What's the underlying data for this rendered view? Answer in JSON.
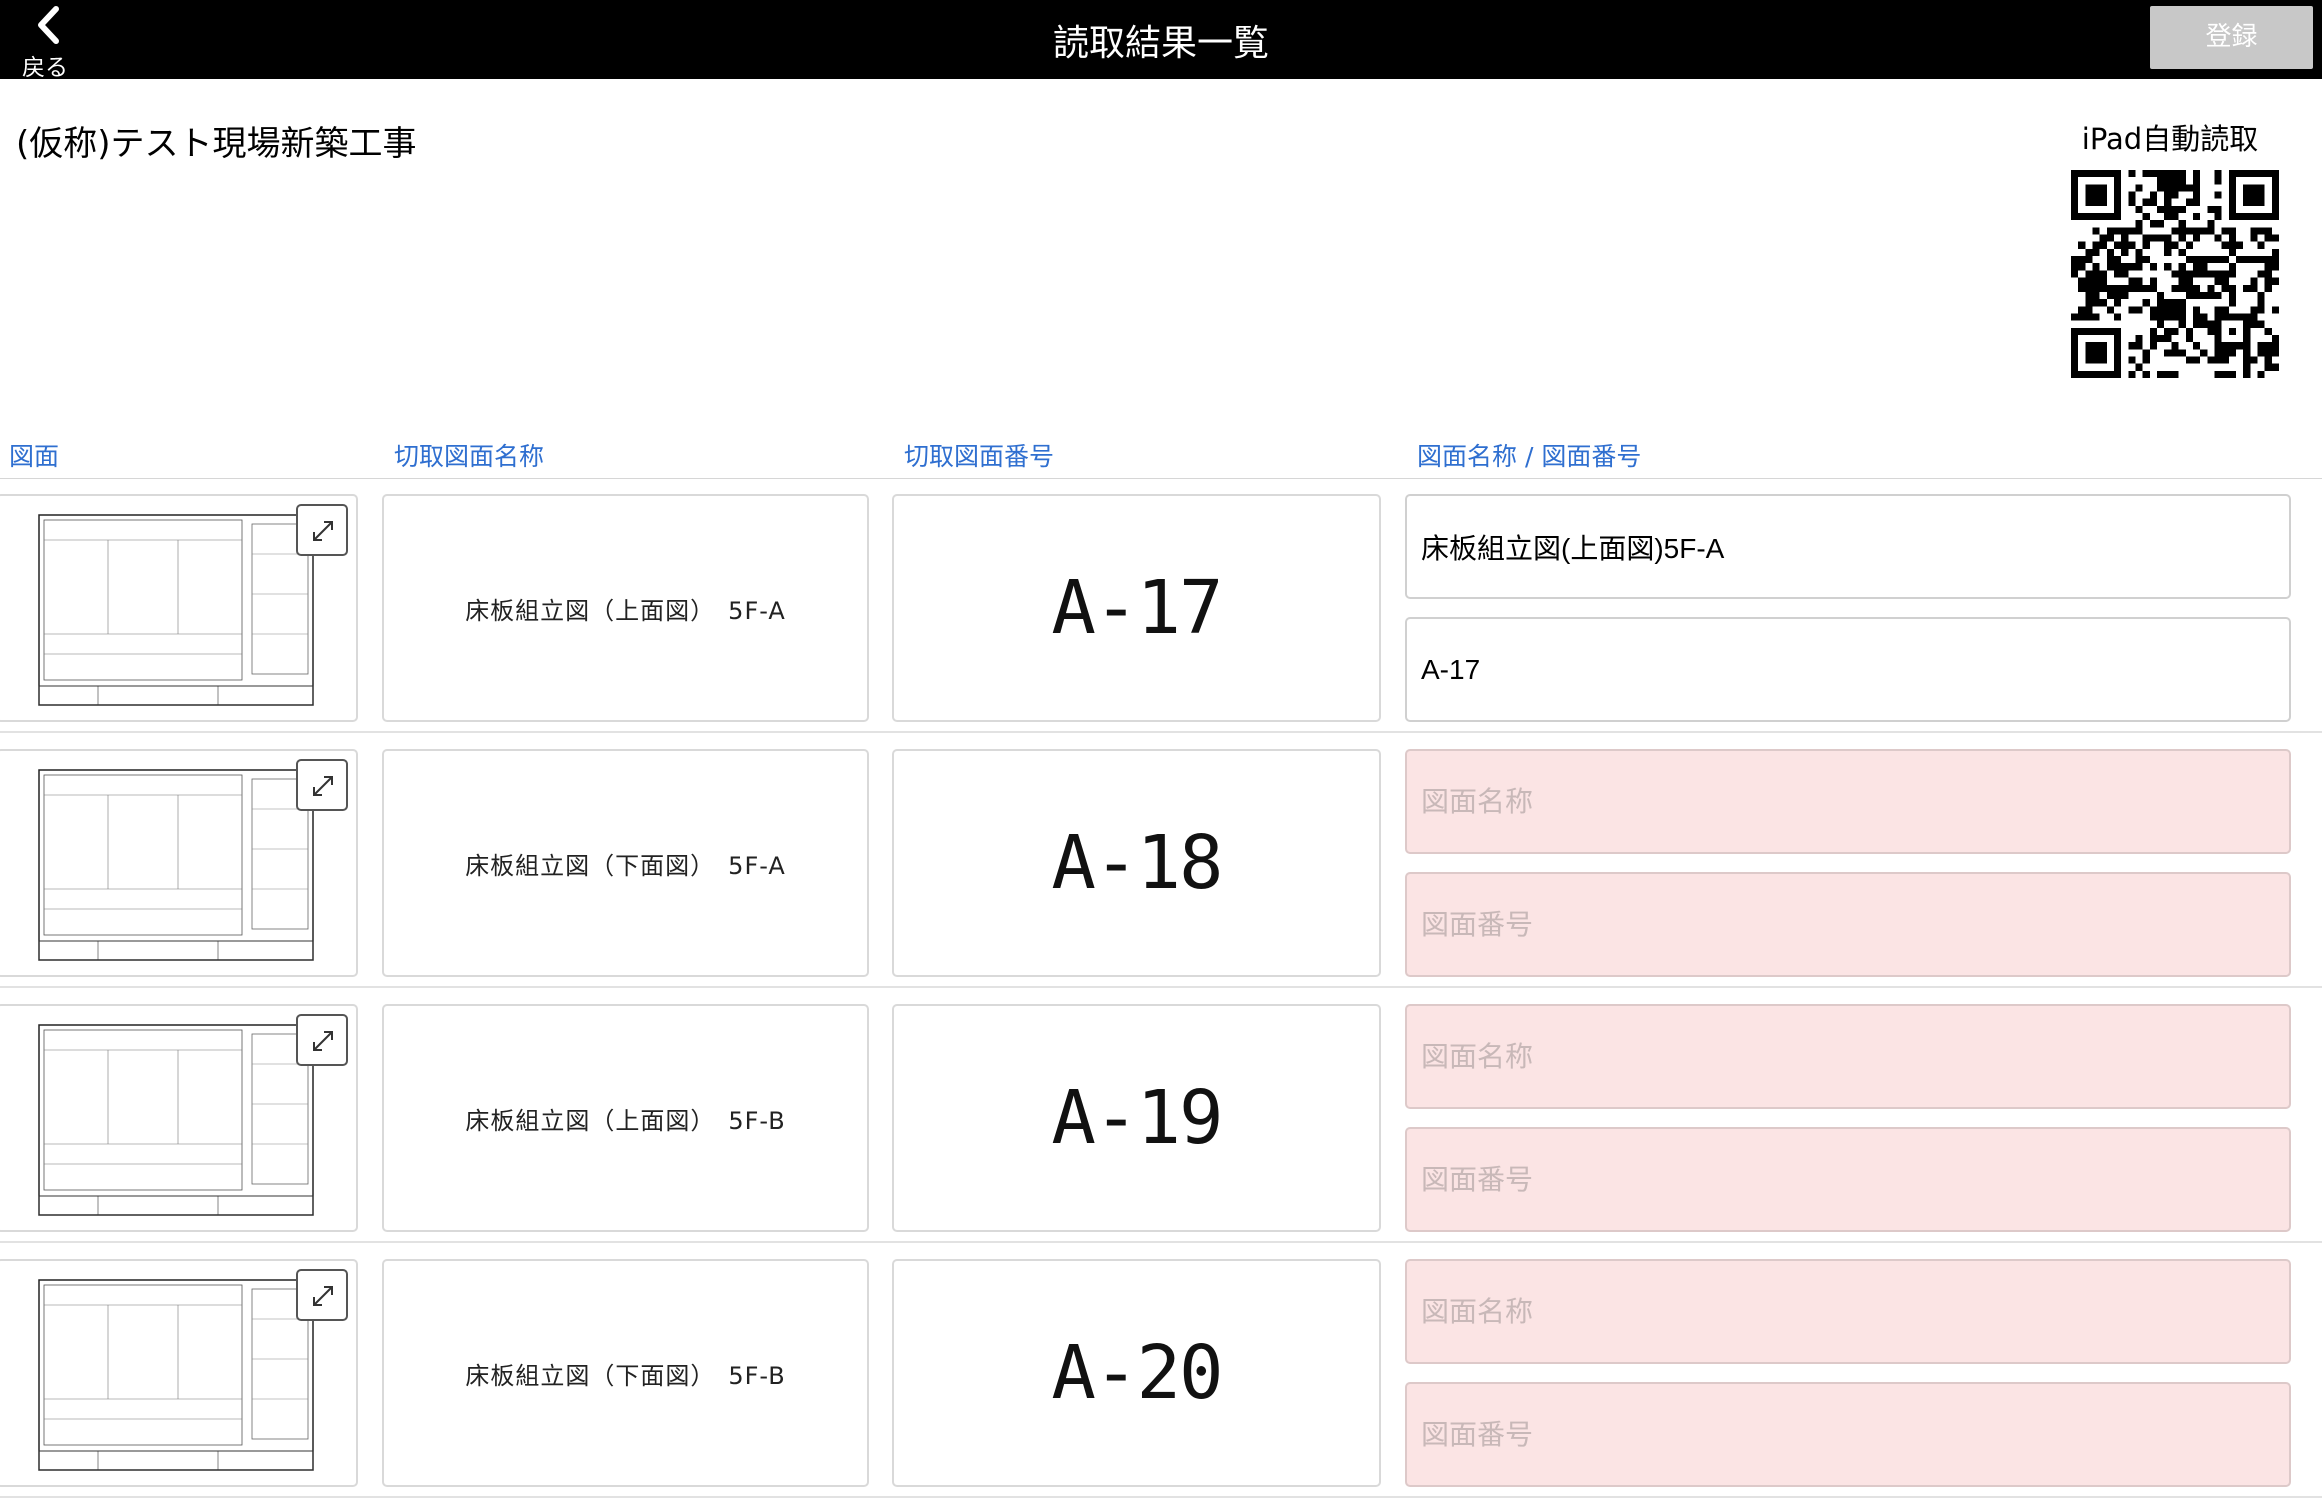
{
  "header": {
    "back_label": "戻る",
    "title": "読取結果一覧",
    "register_label": "登録"
  },
  "project": {
    "name": "(仮称)テスト現場新築工事",
    "qr_label": "iPad自動読取"
  },
  "columns": {
    "drawing": "図面",
    "cut_name": "切取図面名称",
    "cut_number": "切取図面番号",
    "name_number": "図面名称 / 図面番号"
  },
  "rows": [
    {
      "cut_name": "床板組立図（上面図）　5F-A",
      "cut_number": "A-17",
      "name_value": "床板組立図(上面図)5F-A",
      "name_placeholder": "図面名称",
      "number_value": "A-17",
      "number_placeholder": "図面番号"
    },
    {
      "cut_name": "床板組立図（下面図）　5F-A",
      "cut_number": "A-18",
      "name_value": "",
      "name_placeholder": "図面名称",
      "number_value": "",
      "number_placeholder": "図面番号"
    },
    {
      "cut_name": "床板組立図（上面図）　5F-B",
      "cut_number": "A-19",
      "name_value": "",
      "name_placeholder": "図面名称",
      "number_value": "",
      "number_placeholder": "図面番号"
    },
    {
      "cut_name": "床板組立図（下面図）　5F-B",
      "cut_number": "A-20",
      "name_value": "",
      "name_placeholder": "図面名称",
      "number_value": "",
      "number_placeholder": "図面番号"
    }
  ],
  "colors": {
    "header_bg": "#000000",
    "link_blue": "#2f6fd0",
    "empty_field_bg": "#fbe4e4",
    "disabled_button": "#c8c8c8"
  }
}
